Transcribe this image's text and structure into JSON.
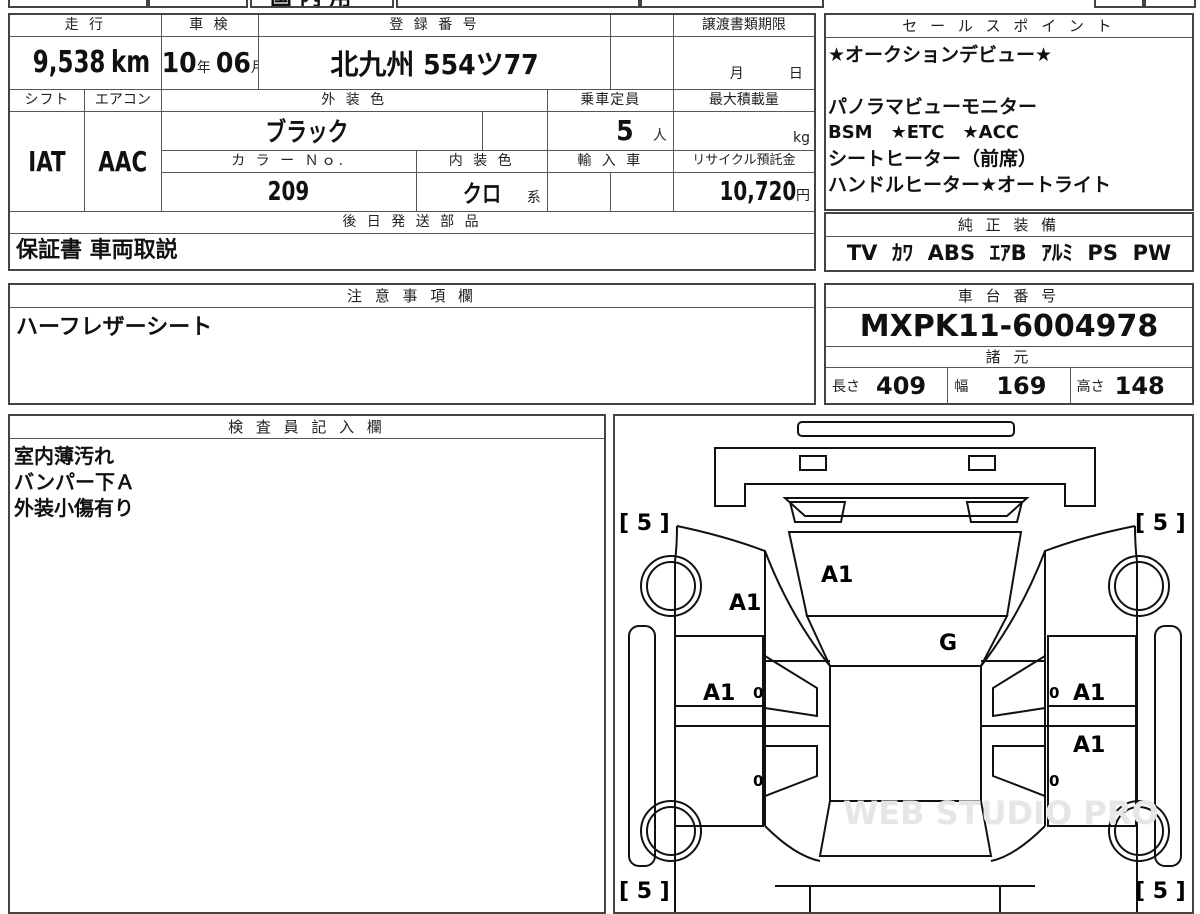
{
  "top_strip": {
    "text_partial": "国 内 用"
  },
  "main": {
    "odometer": {
      "label": "走 行",
      "value": "9,538",
      "unit": "km"
    },
    "shaken": {
      "label": "車 検",
      "year": "10",
      "year_unit": "年",
      "month": "06",
      "month_unit": "月"
    },
    "registration": {
      "label": "登 録 番 号",
      "value": "北九州 554ツ77"
    },
    "transfer_deadline": {
      "label": "譲渡書類期限",
      "month_unit": "月",
      "day_unit": "日"
    },
    "shift": {
      "label": "シフト",
      "value": "IAT"
    },
    "aircon": {
      "label": "エアコン",
      "value": "AAC"
    },
    "exterior_color": {
      "label": "外 装 色",
      "value": "ブラック"
    },
    "seating": {
      "label": "乗車定員",
      "value": "5",
      "unit": "人"
    },
    "max_load": {
      "label": "最大積載量",
      "unit": "kg"
    },
    "color_no": {
      "label": "カ ラ ー Ｎｏ.",
      "value": "209"
    },
    "interior_color": {
      "label": "内 装 色",
      "value": "クロ",
      "suffix": "系"
    },
    "import": {
      "label": "輸 入 車"
    },
    "recycle": {
      "label": "リサイクル預託金",
      "value": "10,720",
      "unit": "円"
    },
    "later_parts": {
      "label": "後 日 発 送 部 品",
      "value": "保証書 車両取説"
    }
  },
  "sales": {
    "label": "セ ー ル ス ポ イ ン ト",
    "lines": [
      "★オークションデビュー★",
      "",
      "パノラマビューモニター",
      "BSM　★ETC　★ACC",
      "シートヒーター（前席）",
      "ハンドルヒーター★オートライト"
    ]
  },
  "equipment": {
    "label": "純 正 装 備",
    "value": "TV  ｶﾜ  ABS  ｴｱB  ｱﾙﾐ  PS  PW"
  },
  "notes": {
    "label": "注 意 事 項 欄",
    "value": "ハーフレザーシート"
  },
  "chassis": {
    "label": "車 台 番 号",
    "value": "MXPK11-6004978"
  },
  "specs": {
    "label": "諸 元",
    "length_label": "長さ",
    "length": "409",
    "width_label": "幅",
    "width": "169",
    "height_label": "高さ",
    "height": "148"
  },
  "inspector": {
    "label": "検 査 員 記 入 欄",
    "lines": [
      "室内薄汚れ",
      "バンパー下Ａ",
      "外装小傷有り"
    ]
  },
  "diagram": {
    "tire_marks": [
      "[ 5 ]",
      "[ 5 ]",
      "[ 5 ]",
      "[ 5 ]"
    ],
    "marks": {
      "roof": "A1",
      "front_left": "A1",
      "windshield": "G",
      "front_door_left": "A1",
      "front_door_right": "A1",
      "rear_door_right": "A1",
      "zero": "0"
    },
    "watermark": "WEB STUDIO PRO"
  }
}
